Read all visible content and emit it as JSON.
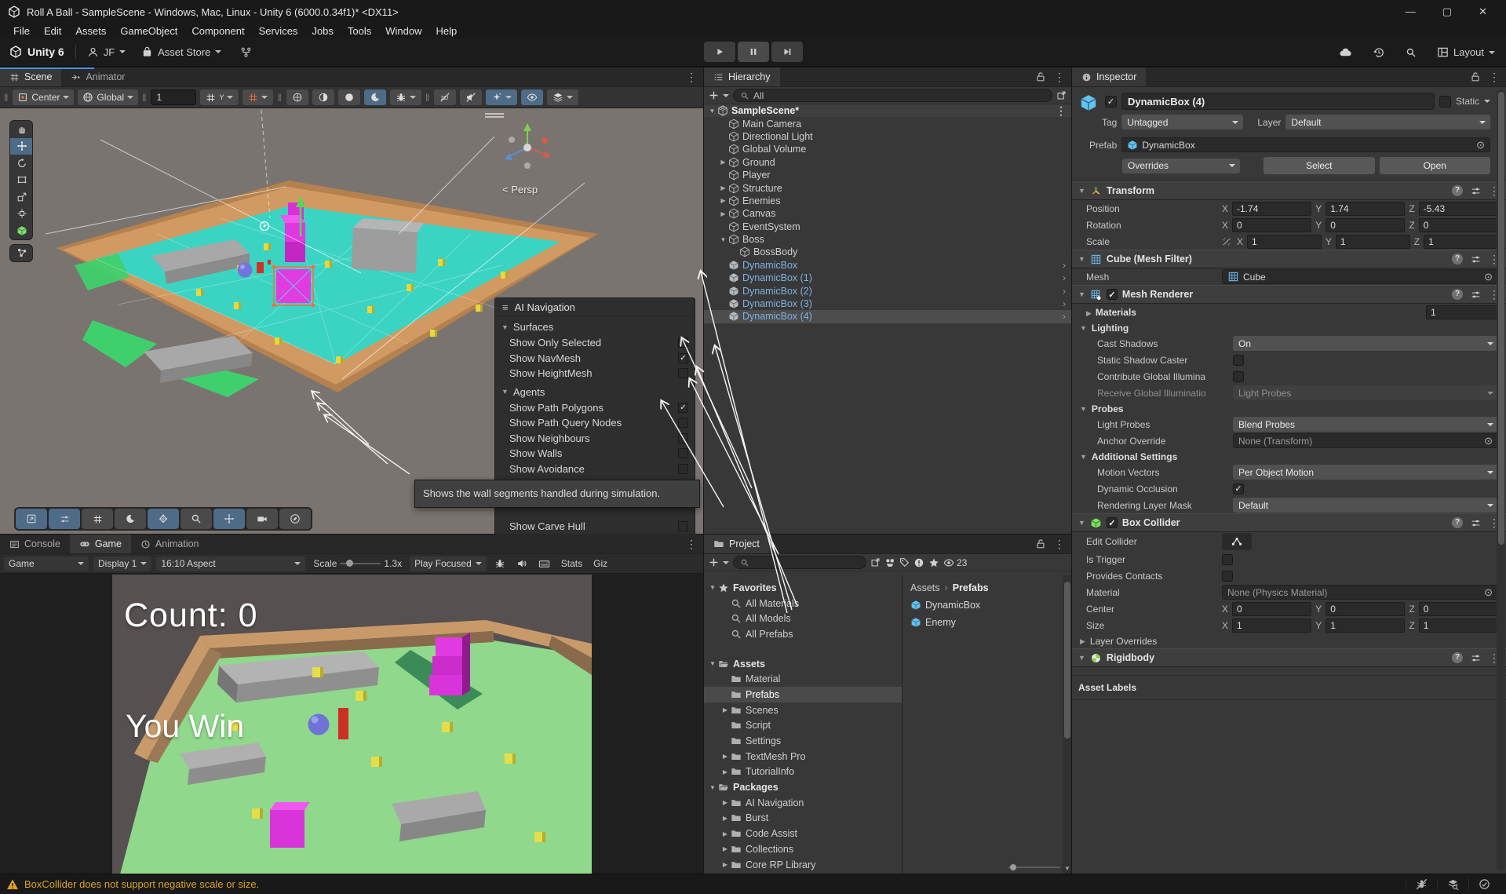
{
  "colors": {
    "accent_blue": "#4a8fe0",
    "prefab_blue": "#7fb1e4",
    "selection_gray": "#4d4d4d",
    "warning_yellow": "#d9a422",
    "navmesh_teal": "#2ed9cb",
    "active_tool_blue": "#4e6b88"
  },
  "icons": {
    "kebab": "⋮",
    "target": "⊙",
    "minimize": "—",
    "maximize": "▢",
    "close": "✕",
    "check": "✓"
  },
  "title_bar": {
    "title": "Roll A Ball - SampleScene - Windows, Mac, Linux - Unity 6 (6000.0.34f1)* <DX11>"
  },
  "menu_bar": {
    "items": [
      "File",
      "Edit",
      "Assets",
      "GameObject",
      "Component",
      "Services",
      "Jobs",
      "Tools",
      "Window",
      "Help"
    ]
  },
  "main_toolbar": {
    "product": "Unity 6",
    "account": "JF",
    "asset_store": "Asset Store",
    "layout": "Layout"
  },
  "scene_panel": {
    "tabs": [
      {
        "label": "Scene",
        "active": true
      },
      {
        "label": "Animator",
        "active": false
      }
    ],
    "toolbar": {
      "pivot": "Center",
      "orientation": "Global",
      "snap_value": "1"
    },
    "persp_label": "< Persp",
    "left_tools": [
      {
        "name": "view-hand-tool"
      },
      {
        "name": "move-tool",
        "active": true
      },
      {
        "name": "rotate-tool"
      },
      {
        "name": "rect-tool"
      },
      {
        "name": "scale-tool"
      },
      {
        "name": "transform-tool"
      },
      {
        "name": "probuilder-tool",
        "green": true
      }
    ],
    "left_tools_extra": [
      {
        "name": "node-graph-tool"
      }
    ],
    "bottom_tools": [
      {
        "name": "fullscreen-tool",
        "active": true
      },
      {
        "name": "view-options-tool",
        "active": true
      },
      {
        "name": "grid-visibility-tool"
      },
      {
        "name": "scene-lighting-tool"
      },
      {
        "name": "navmesh-display-tool",
        "active": true
      },
      {
        "name": "search-tool"
      },
      {
        "name": "move-overlay-tool",
        "active": true
      },
      {
        "name": "camera-preview-tool"
      },
      {
        "name": "compass-tool"
      }
    ]
  },
  "ai_navigation_overlay": {
    "title": "AI Navigation",
    "sections": [
      {
        "label": "Surfaces",
        "items": [
          {
            "label": "Show Only Selected",
            "checked": false
          },
          {
            "label": "Show NavMesh",
            "checked": true
          },
          {
            "label": "Show HeightMesh",
            "checked": false
          }
        ]
      },
      {
        "label": "Agents",
        "items": [
          {
            "label": "Show Path Polygons",
            "checked": true
          },
          {
            "label": "Show Path Query Nodes",
            "checked": false
          },
          {
            "label": "Show Neighbours",
            "checked": false
          },
          {
            "label": "Show Walls",
            "checked": false
          },
          {
            "label": "Show Avoidance",
            "checked": false
          }
        ]
      }
    ],
    "partial_item": {
      "label": "Show Carve Hull",
      "checked": false
    },
    "tooltip": "Shows the wall segments handled during simulation."
  },
  "hierarchy_panel": {
    "tab": "Hierarchy",
    "search_value": "All",
    "items": [
      {
        "label": "SampleScene*",
        "depth": 0,
        "arrow": "down",
        "icon": "scene",
        "bold": true,
        "kebab": true
      },
      {
        "label": "Main Camera",
        "depth": 1,
        "icon": "cube"
      },
      {
        "label": "Directional Light",
        "depth": 1,
        "icon": "cube"
      },
      {
        "label": "Global Volume",
        "depth": 1,
        "icon": "cube"
      },
      {
        "label": "Ground",
        "depth": 1,
        "arrow": "right",
        "icon": "cube"
      },
      {
        "label": "Player",
        "depth": 1,
        "icon": "cube"
      },
      {
        "label": "Structure",
        "depth": 1,
        "arrow": "right",
        "icon": "cube"
      },
      {
        "label": "Enemies",
        "depth": 1,
        "arrow": "right",
        "icon": "cube"
      },
      {
        "label": "Canvas",
        "depth": 1,
        "arrow": "right",
        "icon": "cube"
      },
      {
        "label": "EventSystem",
        "depth": 1,
        "icon": "cube"
      },
      {
        "label": "Boss",
        "depth": 1,
        "arrow": "down",
        "icon": "cube"
      },
      {
        "label": "BossBody",
        "depth": 2,
        "icon": "cube"
      },
      {
        "label": "DynamicBox",
        "depth": 1,
        "icon": "cube-prefab",
        "prefab": true,
        "chevron": true
      },
      {
        "label": "DynamicBox (1)",
        "depth": 1,
        "icon": "cube-prefab",
        "prefab": true,
        "chevron": true
      },
      {
        "label": "DynamicBox (2)",
        "depth": 1,
        "icon": "cube-prefab",
        "prefab": true,
        "chevron": true
      },
      {
        "label": "DynamicBox (3)",
        "depth": 1,
        "icon": "cube-prefab",
        "prefab": true,
        "chevron": true
      },
      {
        "label": "DynamicBox (4)",
        "depth": 1,
        "icon": "cube-prefab",
        "prefab": true,
        "chevron": true,
        "selected": true
      }
    ]
  },
  "inspector_panel": {
    "tab": "Inspector",
    "header": {
      "name": "DynamicBox (4)",
      "static_label": "Static",
      "tag_label": "Tag",
      "tag_value": "Untagged",
      "layer_label": "Layer",
      "layer_value": "Default",
      "prefab_label": "Prefab",
      "prefab_value": "DynamicBox",
      "overrides_label": "Overrides",
      "select_label": "Select",
      "open_label": "Open"
    },
    "components": [
      {
        "icon": "transform-c",
        "title": "Transform",
        "rows": [
          {
            "t": "vec3",
            "label": "Position",
            "x": "-1.74",
            "y": "1.74",
            "z": "-5.43"
          },
          {
            "t": "vec3",
            "label": "Rotation",
            "x": "0",
            "y": "0",
            "z": "0"
          },
          {
            "t": "vec3",
            "label": "Scale",
            "link": true,
            "x": "1",
            "y": "1",
            "z": "1"
          }
        ]
      },
      {
        "icon": "mesh-filter-c",
        "title": "Cube (Mesh Filter)",
        "rows": [
          {
            "t": "object",
            "label": "Mesh",
            "value": "Cube",
            "vicon": "mesh-filter-c"
          }
        ]
      },
      {
        "icon": "mesh-renderer-c",
        "title": "Mesh Renderer",
        "checkbox": true,
        "rows": [
          {
            "t": "materials",
            "label": "Materials",
            "count": "1"
          },
          {
            "t": "sub",
            "label": "Lighting"
          },
          {
            "t": "dropdown",
            "label": "Cast Shadows",
            "value": "On",
            "indent": 1
          },
          {
            "t": "checkbox",
            "label": "Static Shadow Caster",
            "checked": false,
            "indent": 1
          },
          {
            "t": "checkbox",
            "label": "Contribute Global Illumina",
            "checked": false,
            "indent": 1
          },
          {
            "t": "dropdown",
            "label": "Receive Global Illuminatio",
            "value": "Light Probes",
            "disabled": true,
            "indent": 1
          },
          {
            "t": "sub",
            "label": "Probes"
          },
          {
            "t": "dropdown",
            "label": "Light Probes",
            "value": "Blend Probes",
            "indent": 1
          },
          {
            "t": "object",
            "label": "Anchor Override",
            "value": "None (Transform)",
            "muted": true,
            "indent": 1
          },
          {
            "t": "sub",
            "label": "Additional Settings"
          },
          {
            "t": "dropdown",
            "label": "Motion Vectors",
            "value": "Per Object Motion",
            "indent": 1
          },
          {
            "t": "checkbox",
            "label": "Dynamic Occlusion",
            "checked": true,
            "indent": 1
          },
          {
            "t": "dropdown",
            "label": "Rendering Layer Mask",
            "value": "Default",
            "indent": 1
          }
        ]
      },
      {
        "icon": "box-collider-c",
        "title": "Box Collider",
        "checkbox": true,
        "rows": [
          {
            "t": "button",
            "label": "Edit Collider"
          },
          {
            "t": "checkbox",
            "label": "Is Trigger",
            "checked": false
          },
          {
            "t": "checkbox",
            "label": "Provides Contacts",
            "checked": false
          },
          {
            "t": "object",
            "label": "Material",
            "value": "None (Physics Material)",
            "muted": true
          },
          {
            "t": "vec3",
            "label": "Center",
            "x": "0",
            "y": "0",
            "z": "0"
          },
          {
            "t": "vec3",
            "label": "Size",
            "x": "1",
            "y": "1",
            "z": "1"
          },
          {
            "t": "foldout",
            "label": "Layer Overrides"
          }
        ]
      },
      {
        "icon": "rigidbody-c",
        "title": "Rigidbody",
        "rows": []
      }
    ],
    "asset_labels_label": "Asset Labels"
  },
  "bottom_panel": {
    "tabs": [
      {
        "label": "Console",
        "active": false
      },
      {
        "label": "Game",
        "active": true
      },
      {
        "label": "Animation",
        "active": false
      }
    ],
    "toolbar": {
      "display_target": "Game",
      "display": "Display 1",
      "aspect": "16:10 Aspect",
      "scale_label": "Scale",
      "scale_value": "1.3x",
      "play_focused": "Play Focused",
      "stats_label": "Stats",
      "gizmos_label": "Giz"
    },
    "game_view": {
      "count_text": "Count: 0",
      "win_text": "You Win"
    }
  },
  "project_panel": {
    "tab": "Project",
    "visibility_count": "23",
    "breadcrumb": {
      "root": "Assets",
      "current": "Prefabs"
    },
    "tree": [
      {
        "label": "Favorites",
        "depth": 0,
        "icon": "star",
        "arrow": "down",
        "bold": true
      },
      {
        "label": "All Materials",
        "depth": 1,
        "icon": "search"
      },
      {
        "label": "All Models",
        "depth": 1,
        "icon": "search"
      },
      {
        "label": "All Prefabs",
        "depth": 1,
        "icon": "search"
      },
      {
        "t": "spacer"
      },
      {
        "label": "Assets",
        "depth": 0,
        "icon": "folder-open",
        "arrow": "down",
        "bold": true
      },
      {
        "label": "Material",
        "depth": 1,
        "icon": "folder"
      },
      {
        "label": "Prefabs",
        "depth": 1,
        "icon": "folder",
        "selected": true
      },
      {
        "label": "Scenes",
        "depth": 1,
        "icon": "folder",
        "arrow": "right"
      },
      {
        "label": "Script",
        "depth": 1,
        "icon": "folder"
      },
      {
        "label": "Settings",
        "depth": 1,
        "icon": "folder"
      },
      {
        "label": "TextMesh Pro",
        "depth": 1,
        "icon": "folder",
        "arrow": "right"
      },
      {
        "label": "TutorialInfo",
        "depth": 1,
        "icon": "folder",
        "arrow": "right"
      },
      {
        "label": "Packages",
        "depth": 0,
        "icon": "folder-open",
        "arrow": "down",
        "bold": true
      },
      {
        "label": "AI Navigation",
        "depth": 1,
        "icon": "folder",
        "arrow": "right"
      },
      {
        "label": "Burst",
        "depth": 1,
        "icon": "folder",
        "arrow": "right"
      },
      {
        "label": "Code Assist",
        "depth": 1,
        "icon": "folder",
        "arrow": "right"
      },
      {
        "label": "Collections",
        "depth": 1,
        "icon": "folder",
        "arrow": "right"
      },
      {
        "label": "Core RP Library",
        "depth": 1,
        "icon": "folder",
        "arrow": "right"
      }
    ],
    "items": [
      {
        "label": "DynamicBox"
      },
      {
        "label": "Enemy"
      }
    ]
  },
  "status_bar": {
    "warning": "BoxCollider does not support negative scale or size."
  }
}
